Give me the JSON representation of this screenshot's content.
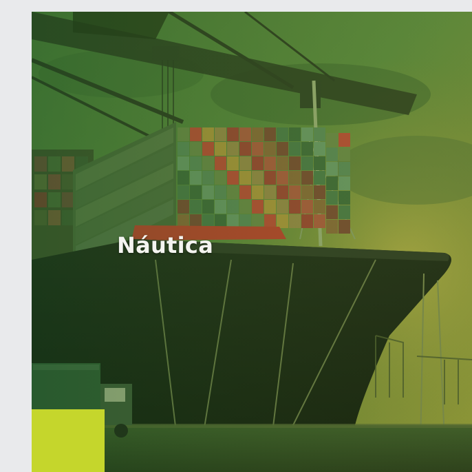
{
  "card": {
    "title": "Náutica",
    "image_subject": "container-ship-at-port",
    "overlay_color": "#3f7a2e",
    "accent_color": "#c5d62c"
  },
  "page": {
    "background_color": "#e9eaec"
  }
}
